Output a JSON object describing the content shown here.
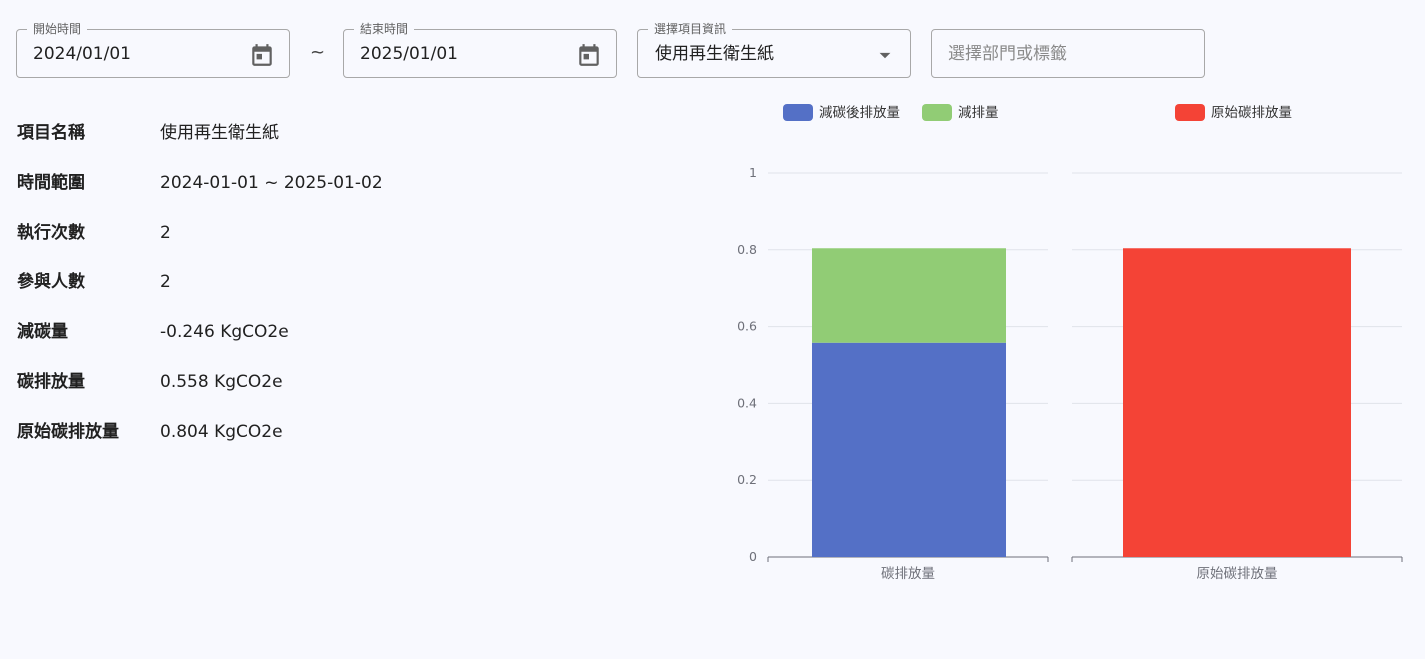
{
  "filters": {
    "start_label": "開始時間",
    "start_value": "2024/01/01",
    "separator": "~",
    "end_label": "結束時間",
    "end_value": "2025/01/01",
    "item_label": "選擇項目資訊",
    "item_value": "使用再生衛生紙",
    "dept_placeholder": "選擇部門或標籤"
  },
  "info": [
    {
      "key": "項目名稱",
      "value": "使用再生衛生紙"
    },
    {
      "key": "時間範圍",
      "value": "2024-01-01 ~ 2025-01-02"
    },
    {
      "key": "執行次數",
      "value": "2"
    },
    {
      "key": "參與人數",
      "value": "2"
    },
    {
      "key": "減碳量",
      "value": "-0.246 KgCO2e"
    },
    {
      "key": "碳排放量",
      "value": "0.558 KgCO2e"
    },
    {
      "key": "原始碳排放量",
      "value": "0.804 KgCO2e"
    }
  ],
  "colors": {
    "reduced_emission": "#5470c6",
    "reduction": "#91cc75",
    "original_emission": "#f44336"
  },
  "chart_data": {
    "type": "bar",
    "categories": [
      "碳排放量",
      "原始碳排放量"
    ],
    "series": [
      {
        "name": "減碳後排放量",
        "category": "碳排放量",
        "value": 0.558,
        "color": "#5470c6",
        "stack": "base"
      },
      {
        "name": "減排量",
        "category": "碳排放量",
        "value": 0.246,
        "color": "#91cc75",
        "stack": "top"
      },
      {
        "name": "原始碳排放量",
        "category": "原始碳排放量",
        "value": 0.804,
        "color": "#f44336",
        "stack": "base"
      }
    ],
    "ylim": [
      0,
      1
    ],
    "yticks": [
      "0",
      "0.2",
      "0.4",
      "0.6",
      "0.8",
      "1"
    ],
    "grid": true,
    "legend": "top"
  }
}
